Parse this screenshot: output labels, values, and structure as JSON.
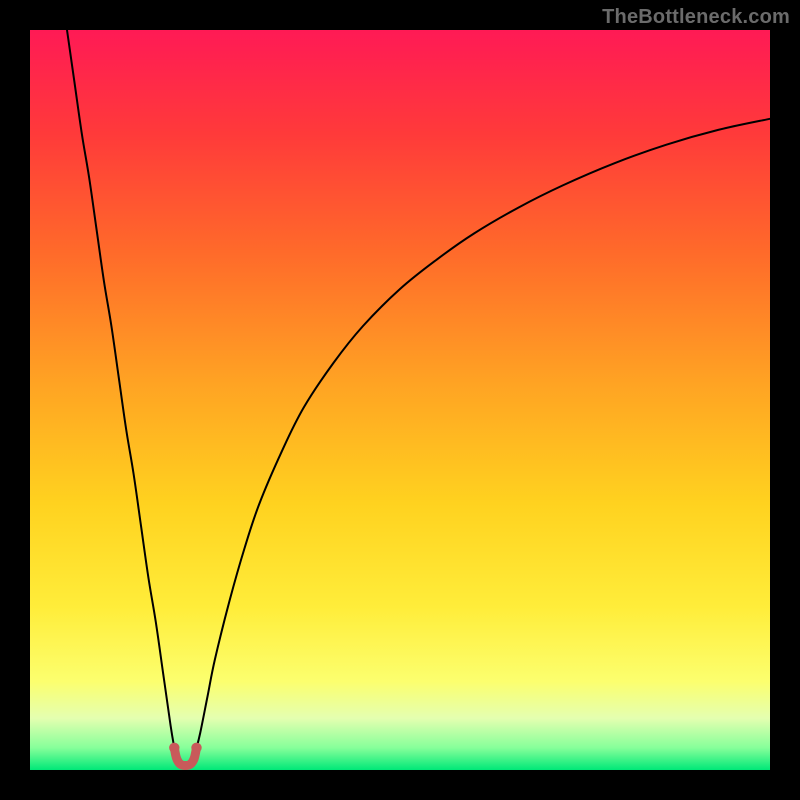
{
  "watermark": "TheBottleneck.com",
  "chart_data": {
    "type": "line",
    "title": "",
    "xlabel": "",
    "ylabel": "",
    "xlim": [
      0,
      100
    ],
    "ylim": [
      0,
      100
    ],
    "gradient_stops": [
      {
        "pct": 0,
        "color": "#ff1a55"
      },
      {
        "pct": 14,
        "color": "#ff3a3a"
      },
      {
        "pct": 30,
        "color": "#ff6a2a"
      },
      {
        "pct": 48,
        "color": "#ffa423"
      },
      {
        "pct": 64,
        "color": "#ffd21f"
      },
      {
        "pct": 78,
        "color": "#ffed3a"
      },
      {
        "pct": 88,
        "color": "#fcff6e"
      },
      {
        "pct": 93,
        "color": "#e4ffb0"
      },
      {
        "pct": 97,
        "color": "#86ff9a"
      },
      {
        "pct": 100,
        "color": "#00e878"
      }
    ],
    "series": [
      {
        "name": "left-branch",
        "x": [
          5,
          6,
          7,
          8,
          9,
          10,
          11,
          12,
          13,
          14,
          15,
          16,
          17,
          18,
          19,
          19.5
        ],
        "y": [
          100,
          93,
          86,
          80,
          73,
          66,
          60,
          53,
          46,
          40,
          33,
          26,
          20,
          13,
          6,
          3
        ]
      },
      {
        "name": "right-branch",
        "x": [
          22.5,
          23,
          24,
          25,
          27,
          29,
          31,
          34,
          37,
          41,
          45,
          50,
          55,
          60,
          66,
          72,
          79,
          86,
          93,
          100
        ],
        "y": [
          3,
          5,
          10,
          15,
          23,
          30,
          36,
          43,
          49,
          55,
          60,
          65,
          69,
          72.5,
          76,
          79,
          82,
          84.5,
          86.5,
          88
        ]
      }
    ],
    "marker": {
      "name": "bottleneck-u-marker",
      "color": "#c85a5a",
      "stroke_width": 9,
      "points_x": [
        19.5,
        19.8,
        20.3,
        21,
        21.7,
        22.2,
        22.5
      ],
      "points_y": [
        3.0,
        1.6,
        0.8,
        0.6,
        0.8,
        1.6,
        3.0
      ],
      "endcap_radius": 5.2
    }
  }
}
